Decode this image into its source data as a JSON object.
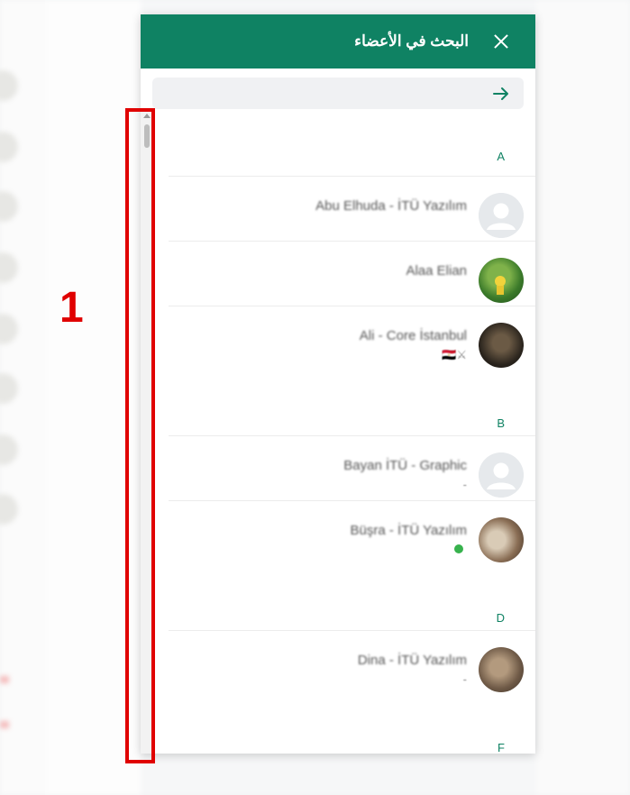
{
  "panel": {
    "title": "البحث في الأعضاء",
    "search_placeholder": ""
  },
  "groups": [
    {
      "letter": "A",
      "members": [
        {
          "name": "Abu Elhuda - İTÜ Yazılım",
          "sub": "",
          "avatar": "default-avatar"
        },
        {
          "name": "Alaa Elian",
          "sub": "",
          "avatar": "photo-avatar"
        },
        {
          "name": "Ali - Core İstanbul",
          "sub": "🇪🇬⚔",
          "avatar": "photo-avatar"
        }
      ]
    },
    {
      "letter": "B",
      "members": [
        {
          "name": "Bayan İTÜ - Graphic",
          "sub": "-",
          "avatar": "default-avatar"
        },
        {
          "name": "Büşra - İTÜ Yazılım",
          "sub": "",
          "avatar": "photo-avatar",
          "status": "online"
        }
      ]
    },
    {
      "letter": "D",
      "members": [
        {
          "name": "Dina - İTÜ Yazılım",
          "sub": "-",
          "avatar": "photo-avatar"
        }
      ]
    },
    {
      "letter": "F",
      "members": []
    }
  ],
  "annotation": {
    "label": "1"
  },
  "colors": {
    "header": "#0f8263",
    "accent": "#0f8263",
    "annotation": "#e00000"
  }
}
